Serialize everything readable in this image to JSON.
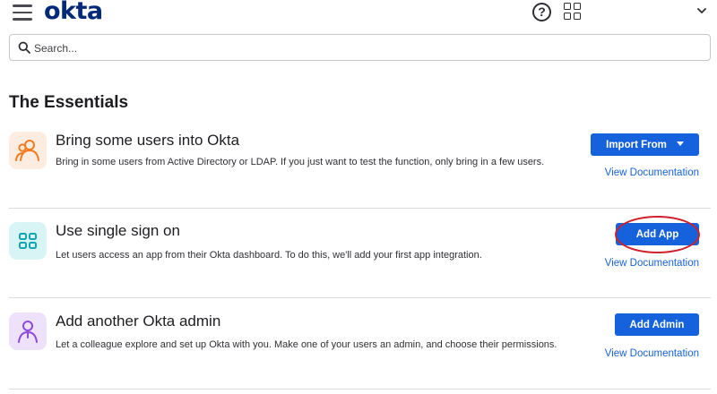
{
  "header": {
    "logo_text": "okta",
    "help_icon": "question-circle-icon",
    "apps_icon": "grid-icon",
    "menu_icon": "hamburger-icon",
    "profile_icon": "chevron-down-icon",
    "brand_color": "#00297a"
  },
  "search": {
    "placeholder": "Search...",
    "value": "",
    "icon": "search-icon"
  },
  "essentials": {
    "title": "The Essentials",
    "accent_color": "#1662dd",
    "cards": [
      {
        "icon": "users-icon",
        "icon_color": "#f47b20",
        "icon_bg": "#fdece0",
        "title": "Bring some users into Okta",
        "description": "Bring in some users from Active Directory or LDAP. If you just want to test the function, only bring in a few users.",
        "button_label": "Import From",
        "doc_link": "View Documentation"
      },
      {
        "icon": "apps-grid-icon",
        "icon_color": "#12a5b3",
        "icon_bg": "#d8f4f5",
        "title": "Use single sign on",
        "description": "Let users access an app from their Okta dashboard. To do this, we'll add your first app integration.",
        "button_label": "Add App",
        "doc_link": "View Documentation"
      },
      {
        "icon": "admin-icon",
        "icon_color": "#8d4bd8",
        "icon_bg": "#ede2fa",
        "title": "Add another Okta admin",
        "description": "Let a colleague explore and set up Okta with you. Make one of your users an admin, and choose their permissions.",
        "button_label": "Add Admin",
        "doc_link": "View Documentation"
      }
    ]
  }
}
